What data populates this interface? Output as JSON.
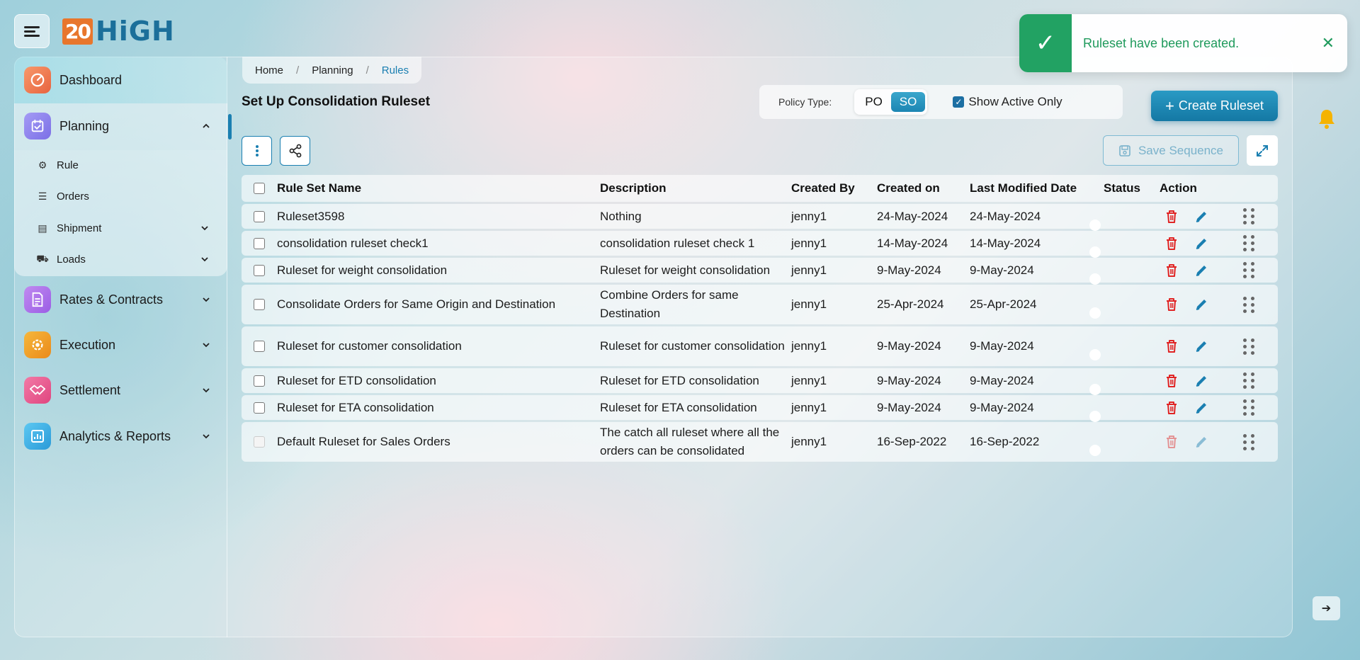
{
  "app": {
    "logo_number": "20",
    "logo_word": "HiGH"
  },
  "sidebar": {
    "items": [
      {
        "label": "Dashboard",
        "icon": "dashboard-icon"
      },
      {
        "label": "Planning",
        "icon": "planning-icon"
      },
      {
        "label": "Rates & Contracts",
        "icon": "contract-icon"
      },
      {
        "label": "Execution",
        "icon": "execution-icon"
      },
      {
        "label": "Settlement",
        "icon": "handshake-icon"
      },
      {
        "label": "Analytics & Reports",
        "icon": "report-icon"
      }
    ],
    "planning_sub": [
      {
        "label": "Rule",
        "icon": "gear-icon"
      },
      {
        "label": "Orders",
        "icon": "list-icon"
      },
      {
        "label": "Shipment",
        "icon": "box-icon"
      },
      {
        "label": "Loads",
        "icon": "truck-icon"
      }
    ]
  },
  "breadcrumb": {
    "home": "Home",
    "section": "Planning",
    "current": "Rules"
  },
  "page": {
    "title": "Set Up Consolidation Ruleset"
  },
  "policy": {
    "label": "Policy Type:",
    "option_po": "PO",
    "option_so": "SO",
    "selected": "SO"
  },
  "filters": {
    "show_active_label": "Show Active Only",
    "show_active_checked": true
  },
  "toolbar": {
    "create_label": "Create Ruleset",
    "save_sequence_label": "Save Sequence"
  },
  "table": {
    "headers": [
      "Rule Set Name",
      "Description",
      "Created By",
      "Created on",
      "Last Modified Date",
      "Status",
      "Action"
    ],
    "rows": [
      {
        "name": "Ruleset3598",
        "description": "Nothing",
        "created_by": "jenny1",
        "created_on": "24-May-2024",
        "modified": "24-May-2024",
        "active": true
      },
      {
        "name": "consolidation ruleset check1",
        "description": "consolidation ruleset check 1",
        "created_by": "jenny1",
        "created_on": "14-May-2024",
        "modified": "14-May-2024",
        "active": true
      },
      {
        "name": "Ruleset for weight consolidation",
        "description": "Ruleset for weight consolidation",
        "created_by": "jenny1",
        "created_on": "9-May-2024",
        "modified": "9-May-2024",
        "active": true
      },
      {
        "name": "Consolidate Orders for Same Origin and Destination",
        "description": "Combine Orders for same Destination",
        "created_by": "jenny1",
        "created_on": "25-Apr-2024",
        "modified": "25-Apr-2024",
        "active": true
      },
      {
        "name": "Ruleset for customer consolidation",
        "description": "Ruleset for customer consolidation",
        "created_by": "jenny1",
        "created_on": "9-May-2024",
        "modified": "9-May-2024",
        "active": true
      },
      {
        "name": "Ruleset for ETD consolidation",
        "description": "Ruleset for ETD consolidation",
        "created_by": "jenny1",
        "created_on": "9-May-2024",
        "modified": "9-May-2024",
        "active": true
      },
      {
        "name": "Ruleset for ETA consolidation",
        "description": "Ruleset for ETA consolidation",
        "created_by": "jenny1",
        "created_on": "9-May-2024",
        "modified": "9-May-2024",
        "active": true
      },
      {
        "name": "Default Ruleset for Sales Orders",
        "description": "The catch all ruleset where all the orders can be consolidated",
        "created_by": "jenny1",
        "created_on": "16-Sep-2022",
        "modified": "16-Sep-2022",
        "active": true
      }
    ]
  },
  "toast": {
    "message": "Ruleset have been created.",
    "type": "success"
  },
  "colors": {
    "accent": "#1a7fb1",
    "success": "#22a263",
    "danger": "#e02424"
  }
}
